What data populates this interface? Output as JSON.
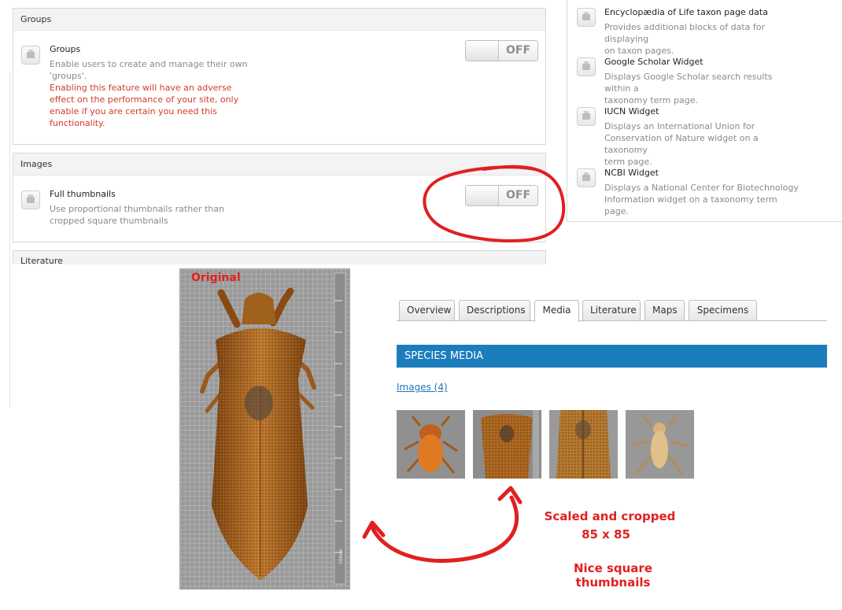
{
  "groups_panel": {
    "header": "Groups",
    "feature_title": "Groups",
    "desc_lines": [
      "Enable users to create and manage their own",
      "'groups'."
    ],
    "warning_lines": [
      "Enabling this feature will have an adverse",
      "effect on the performance of your site, only",
      "enable if you are certain you need this",
      "functionality."
    ],
    "toggle_state": "OFF"
  },
  "images_panel": {
    "header": "Images",
    "feature_title": "Full thumbnails",
    "desc_lines": [
      "Use proportional thumbnails rather than",
      "cropped square thumbnails"
    ],
    "toggle_state": "OFF"
  },
  "literature_panel": {
    "header": "Literature"
  },
  "right_column": {
    "items": [
      {
        "title": "Encyclopædia of Life taxon page data",
        "desc_lines": [
          "Provides additional blocks of data for displaying",
          "on taxon pages."
        ]
      },
      {
        "title": "Google Scholar Widget",
        "desc_lines": [
          "Displays Google Scholar search results within a",
          "taxonomy term page."
        ]
      },
      {
        "title": "IUCN Widget",
        "desc_lines": [
          "Displays an International Union for",
          "Conservation of Nature widget on a taxonomy",
          "term page."
        ]
      },
      {
        "title": "NCBI Widget",
        "desc_lines": [
          "Displays a National Center for Biotechnology",
          "Information widget on a taxonomy term page."
        ]
      }
    ]
  },
  "original_label": "Original",
  "scale_label": "10mm",
  "tabs": [
    "Overview",
    "Descriptions",
    "Media",
    "Literature",
    "Maps",
    "Specimens"
  ],
  "active_tab": "Media",
  "species_media_title": "SPECIES MEDIA",
  "images_link": "Images (4)",
  "annotation": {
    "line1": "Scaled and cropped",
    "line2": "85 x 85",
    "line3": "Nice square thumbnails"
  },
  "colors": {
    "accent_blue": "#1c7dbd",
    "annotation_red": "#e02020",
    "warning_red": "#d23b2b"
  }
}
